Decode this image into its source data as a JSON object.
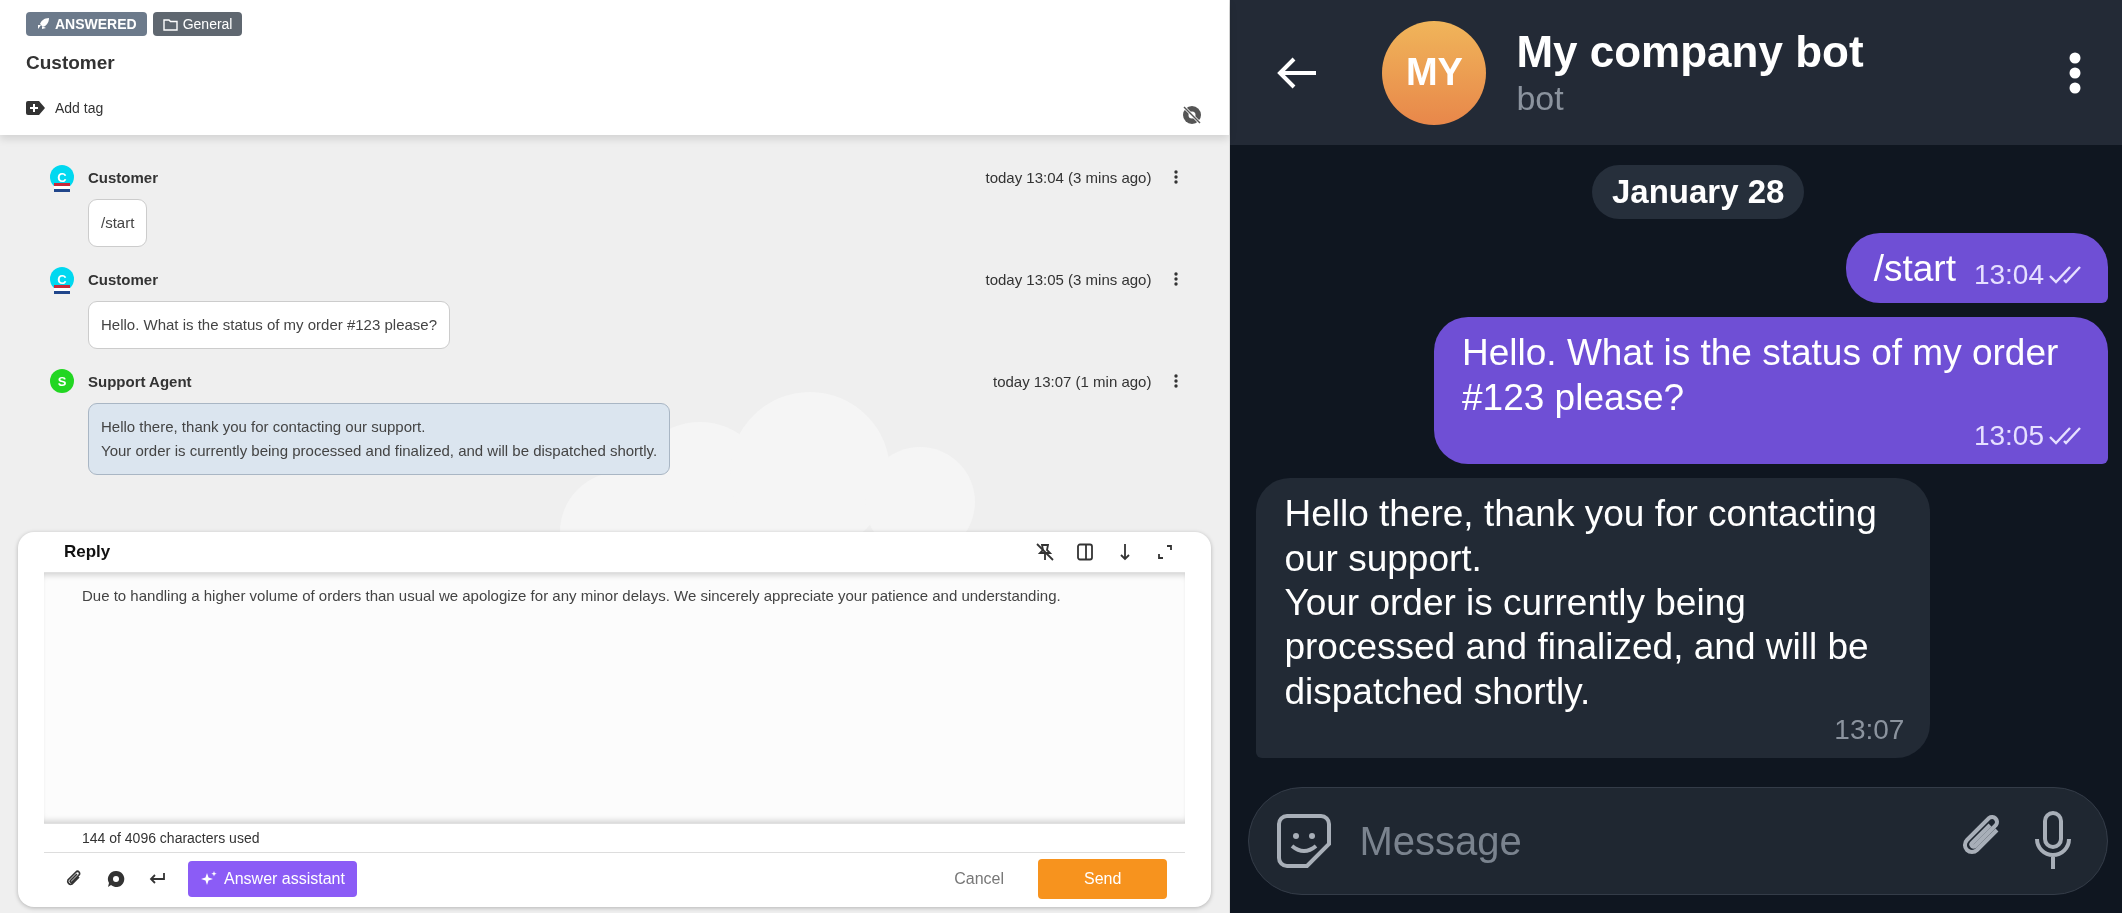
{
  "ticket": {
    "tags": [
      {
        "kind": "status",
        "label": "ANSWERED"
      },
      {
        "kind": "folder",
        "label": "General"
      }
    ],
    "title": "Customer",
    "add_tag": "Add tag"
  },
  "messages": [
    {
      "kind": "customer",
      "sender": "Customer",
      "avatar": "C",
      "color": "#00d8f0",
      "time": "today 13:04 (3 mins ago)",
      "text": "/start"
    },
    {
      "kind": "customer",
      "sender": "Customer",
      "avatar": "C",
      "color": "#00d8f0",
      "time": "today 13:05 (3 mins ago)",
      "text": "Hello. What is the status of my order #123 please?"
    },
    {
      "kind": "agent",
      "sender": "Support Agent",
      "avatar": "S",
      "color": "#22d622",
      "time": "today 13:07 (1 min ago)",
      "text": "Hello there, thank you for contacting our support.\nYour order is currently being processed and finalized, and will be dispatched shortly."
    }
  ],
  "reply": {
    "title": "Reply",
    "value": "Due to handling a higher volume of orders than usual we apologize for any minor delays. We sincerely appreciate your patience and understanding.",
    "counter": "144 of 4096 characters used",
    "assistant": "Answer assistant",
    "cancel": "Cancel",
    "send": "Send"
  },
  "chat": {
    "title": "My company bot",
    "subtitle": "bot",
    "avatar": "MY",
    "date": "January 28",
    "messages": [
      {
        "kind": "outgoing",
        "text": "/start",
        "time": "13:04",
        "read": true
      },
      {
        "kind": "outgoing",
        "text": "Hello. What is the status of my order #123 please?",
        "time": "13:05",
        "read": true
      },
      {
        "kind": "incoming",
        "text": "Hello there, thank you for contacting our support.\nYour order is currently being processed and finalized, and will be dispatched shortly.",
        "time": "13:07"
      }
    ],
    "input": {
      "placeholder": "Message"
    }
  }
}
